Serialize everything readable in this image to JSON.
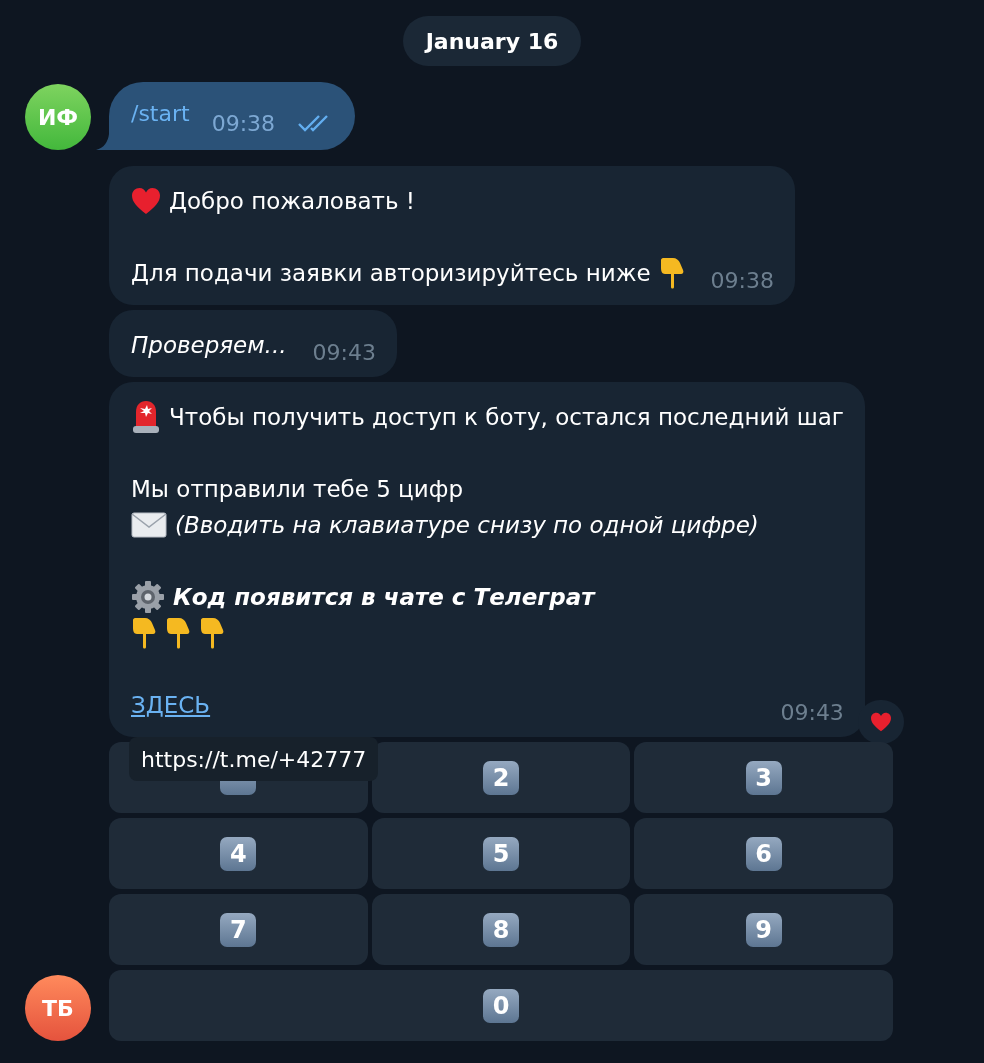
{
  "date_badge": "January 16",
  "outgoing": {
    "avatar": "ИФ",
    "text": "/start",
    "time": "09:38",
    "read": true
  },
  "incoming": {
    "avatar": "ТБ",
    "messages": [
      {
        "time": "09:38",
        "reacted": false,
        "lines": [
          {
            "kind": "heart",
            "text": "Добро пожаловать !"
          },
          {
            "kind": "blank"
          },
          {
            "kind": "pointing",
            "text": "Для подачи заявки авторизируйтесь ниже"
          }
        ]
      },
      {
        "time": "09:43",
        "reacted": false,
        "lines": [
          {
            "kind": "italic",
            "text": "Проверяем..."
          }
        ]
      },
      {
        "time": "09:43",
        "reacted": true,
        "lines": [
          {
            "kind": "siren",
            "text": "Чтобы получить доступ к боту, остался последний шаг"
          },
          {
            "kind": "blank"
          },
          {
            "kind": "plain",
            "text": "Мы отправили тебе 5 цифр"
          },
          {
            "kind": "envelope",
            "text": "(Вводить на клавиатуре снизу по одной цифре)"
          },
          {
            "kind": "blank"
          },
          {
            "kind": "gear",
            "text": "Код появится в чате с Телеграт"
          },
          {
            "kind": "hands"
          },
          {
            "kind": "blank"
          },
          {
            "kind": "link",
            "text": "ЗДЕСЬ"
          }
        ]
      }
    ]
  },
  "tooltip": "https://t.me/+42777",
  "keyboard": [
    [
      {
        "kind": "covered"
      },
      {
        "kind": "digit",
        "label": "2"
      },
      {
        "kind": "digit",
        "label": "3"
      }
    ],
    [
      {
        "kind": "digit",
        "label": "4"
      },
      {
        "kind": "digit",
        "label": "5"
      },
      {
        "kind": "digit",
        "label": "6"
      }
    ],
    [
      {
        "kind": "digit",
        "label": "7"
      },
      {
        "kind": "digit",
        "label": "8"
      },
      {
        "kind": "digit",
        "label": "9"
      }
    ],
    [
      {
        "kind": "digit",
        "label": "0"
      }
    ]
  ]
}
